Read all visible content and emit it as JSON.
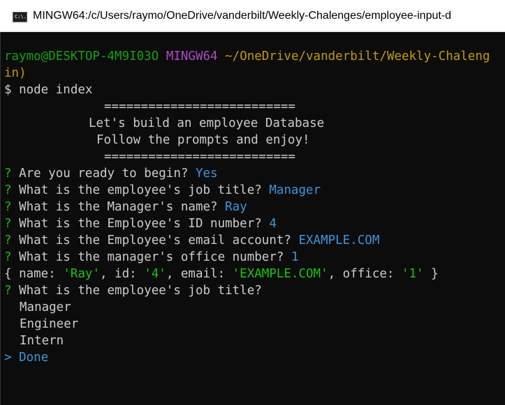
{
  "window": {
    "title": "MINGW64:/c/Users/raymo/OneDrive/vanderbilt/Weekly-Chalenges/employee-input-d",
    "icon": "terminal-icon",
    "icon_text": "C:\\."
  },
  "prompt": {
    "user_host": "raymo@DESKTOP-4M9I03O",
    "env": "MINGW64",
    "path": "~/OneDrive/vanderbilt/Weekly-Chaleng",
    "path_cont": "in)",
    "command": "$ node index"
  },
  "banner": {
    "rule_top": "==========================",
    "line1": "Let's build an employee Database",
    "line2": "Follow the prompts and enjoy!",
    "rule_bottom": "=========================="
  },
  "questions": [
    {
      "mark": "?",
      "text": "Are you ready to begin?",
      "answer": "Yes"
    },
    {
      "mark": "?",
      "text": "What is the employee's job title?",
      "answer": "Manager"
    },
    {
      "mark": "?",
      "text": "What is the Manager's name?",
      "answer": "Ray"
    },
    {
      "mark": "?",
      "text": "What is the Employee's ID number?",
      "answer": "4"
    },
    {
      "mark": "?",
      "text": "What is the Employee's email account?",
      "answer": "EXAMPLE.COM"
    },
    {
      "mark": "?",
      "text": "What is the manager's office number?",
      "answer": "1"
    }
  ],
  "object_output": {
    "open": "{ name: ",
    "name_val": "'Ray'",
    "id_key": ", id: ",
    "id_val": "'4'",
    "email_key": ", email: ",
    "email_val": "'EXAMPLE.COM'",
    "office_key": ", office: ",
    "office_val": "'1'",
    "close": " }"
  },
  "current_question": {
    "mark": "?",
    "text": "What is the employee's job title?"
  },
  "choices": [
    {
      "label": "Manager",
      "selected": false
    },
    {
      "label": "Engineer",
      "selected": false
    },
    {
      "label": "Intern",
      "selected": false
    },
    {
      "label": "Done",
      "selected": true,
      "pointer": ">"
    }
  ],
  "colors": {
    "background": "#0c0c0c",
    "text": "#cccccc",
    "prompt_green": "#13a10e",
    "env_purple": "#b148c6",
    "path_yellow": "#c19c00",
    "answer_cyan": "#3a96dd",
    "string_green": "#16c60c"
  }
}
